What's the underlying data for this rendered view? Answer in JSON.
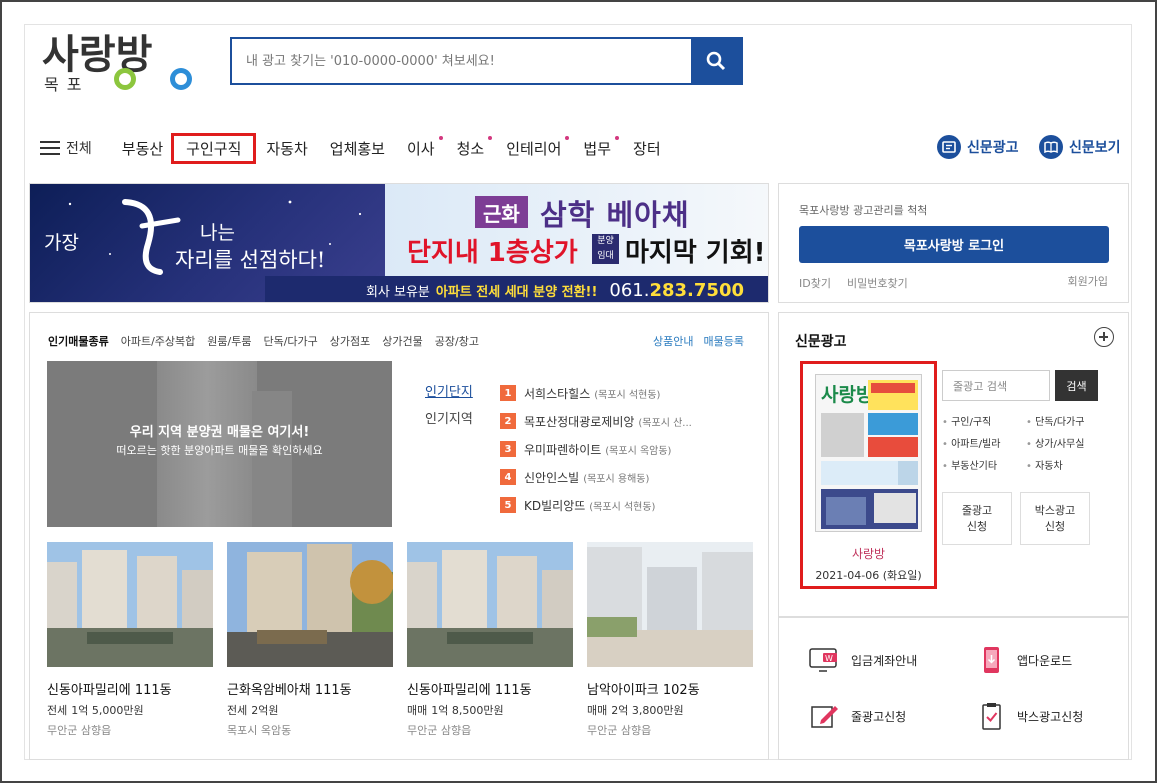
{
  "brand": {
    "name": "사랑방",
    "region": "목포"
  },
  "search": {
    "placeholder": "내 광고 찾기는 '010-0000-0000' 쳐보세요!"
  },
  "nav": {
    "all_label": "전체",
    "items": [
      {
        "label": "부동산",
        "dot": false
      },
      {
        "label": "구인구직",
        "dot": false,
        "highlighted": true
      },
      {
        "label": "자동차",
        "dot": false
      },
      {
        "label": "업체홍보",
        "dot": false
      },
      {
        "label": "이사",
        "dot": true
      },
      {
        "label": "청소",
        "dot": true
      },
      {
        "label": "인테리어",
        "dot": true
      },
      {
        "label": "법무",
        "dot": true
      },
      {
        "label": "장터",
        "dot": false
      }
    ],
    "right": [
      {
        "label": "신문광고"
      },
      {
        "label": "신문보기"
      }
    ]
  },
  "banner": {
    "left_line1": "가장",
    "left_line2": "나는",
    "left_line3": "자리를 선점하다!",
    "tag": "근화",
    "title": "삼학 베아채",
    "red_text": "단지내 1층상가",
    "badge_top": "분양",
    "badge_bottom": "임대",
    "black_text": "마지막 기회!",
    "strip_text": "회사 보유분",
    "strip_highlight": "아파트 전세 세대 분양 전환!!",
    "phone_prefix": "061.",
    "phone_main": "283.7500"
  },
  "login": {
    "caption": "목포사랑방 광고관리를 척척",
    "button": "목포사랑방 로그인",
    "find_id": "ID찾기",
    "find_pw": "비밀번호찾기",
    "join": "회원가입"
  },
  "listing": {
    "category_title": "인기매물종류",
    "categories": [
      "아파트/주상복합",
      "원룸/투룸",
      "단독/다가구",
      "상가점포",
      "상가건물",
      "공장/창고"
    ],
    "right_links": [
      "상품안내",
      "매물등록"
    ],
    "promo_title": "우리 지역 분양권 매물은 여기서!",
    "promo_sub": "떠오르는 핫한 분양아파트 매물을 확인하세요",
    "tabs": [
      "인기단지",
      "인기지역"
    ],
    "ranking": [
      {
        "no": "1",
        "name": "서희스타힐스",
        "loc": "(목포시 석현동)"
      },
      {
        "no": "2",
        "name": "목포산정대광로제비앙",
        "loc": "(목포시 산..."
      },
      {
        "no": "3",
        "name": "우미파렌하이트",
        "loc": "(목포시 옥암동)"
      },
      {
        "no": "4",
        "name": "신안인스빌",
        "loc": "(목포시 용해동)"
      },
      {
        "no": "5",
        "name": "KD빌리앙뜨",
        "loc": "(목포시 석현동)"
      }
    ],
    "cards": [
      {
        "name": "신동아파밀리에 111동",
        "type": "전세",
        "price": "1억 5,000만원",
        "addr": "무안군 삼향읍"
      },
      {
        "name": "근화옥암베아채 111동",
        "type": "전세",
        "price": "2억원",
        "addr": "목포시 옥암동"
      },
      {
        "name": "신동아파밀리에 111동",
        "type": "매매",
        "price": "1억 8,500만원",
        "addr": "무안군 삼향읍"
      },
      {
        "name": "남악아이파크 102동",
        "type": "매매",
        "price": "2억 3,800만원",
        "addr": "무안군 삼향읍"
      }
    ]
  },
  "newspaper": {
    "title": "신문광고",
    "paper_name": "사랑방",
    "paper_date": "2021-04-06 (화요일)",
    "search_placeholder": "줄광고 검색",
    "search_button": "검색",
    "cats": [
      "구인/구직",
      "단독/다가구",
      "아파트/빌라",
      "상가/사무실",
      "부동산기타",
      "자동차"
    ],
    "btn_line": [
      "줄광고",
      "신청"
    ],
    "btn_box": [
      "박스광고",
      "신청"
    ]
  },
  "quick_links": [
    {
      "label": "입금계좌안내",
      "icon": "monitor-won-icon"
    },
    {
      "label": "앱다운로드",
      "icon": "phone-download-icon"
    },
    {
      "label": "줄광고신청",
      "icon": "pencil-form-icon"
    },
    {
      "label": "박스광고신청",
      "icon": "clipboard-check-icon"
    }
  ],
  "colors": {
    "primary": "#1c4f9c",
    "highlight": "#e01c1c",
    "rank": "#f06a3c",
    "logo_green": "#8cc63e",
    "logo_blue": "#2d8ed8"
  }
}
